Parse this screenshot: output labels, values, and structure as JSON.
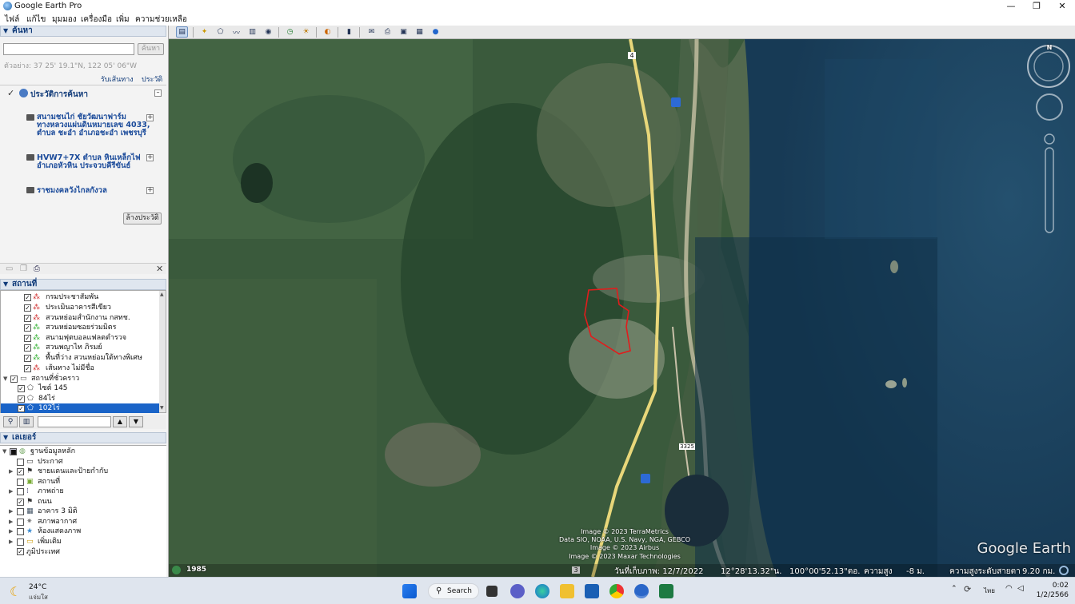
{
  "window": {
    "title": "Google Earth Pro",
    "minimize": "—",
    "maximize": "❐",
    "close": "✕"
  },
  "menu": [
    "ไฟล์",
    "แก้ไข",
    "มุมมอง",
    "เครื่องมือ",
    "เพิ่ม",
    "ความช่วยเหลือ"
  ],
  "search": {
    "header": "ค้นหา",
    "input_value": "",
    "button": "ค้นหา",
    "example": "ตัวอย่าง: 37 25' 19.1\"N, 122 05' 06\"W",
    "link_directions": "รับเส้นทาง",
    "link_history": "ประวัติ",
    "history_title": "ประวัติการค้นหา",
    "history_items": [
      "สนามชนไก่ ชัยวัฒนาฟาร์ม ทางหลวงแผ่นดินหมายเลข 4033, ตำบล ชะอำ อำเภอชะอำ เพชรบุรี",
      "HVW7+7X ตำบล หินเหล็กไฟ อำเภอหัวหิน ประจวบคีรีขันธ์",
      "ราชมงคลวังไกลกังวล"
    ],
    "clear_history": "ล้างประวัติ"
  },
  "places": {
    "header": "สถานที่",
    "items": [
      "กรมประชาสัมพัน",
      "ประเมินอาคารสีเขียว",
      "สวนหย่อมสำนักงาน กสทช.",
      "สวนหย่อมซอยร่วมมิตร",
      "สนามฟุตบอลแฟลตตำรวจ",
      "สวนพญาไท ภิรมย์",
      "พื้นที่ว่าง สวนหย่อมใต้ทางพิเศษ",
      "เส้นทาง ไม่มีชื่อ"
    ],
    "temp_folder": "สถานที่ชั่วคราว",
    "temp_items": [
      "ไซต์ 145",
      "84ไร่",
      "102ไร่"
    ],
    "filter_value": ""
  },
  "layers": {
    "header": "เลเยอร์",
    "root": "ฐานข้อมูลหลัก",
    "items": [
      {
        "label": "ประกาศ",
        "checked": false
      },
      {
        "label": "ชายแดนและป้ายกำกับ",
        "checked": true
      },
      {
        "label": "สถานที่",
        "checked": false
      },
      {
        "label": "ภาพถ่าย",
        "checked": false
      },
      {
        "label": "ถนน",
        "checked": true
      },
      {
        "label": "อาคาร 3 มิติ",
        "checked": false
      },
      {
        "label": "สภาพอากาศ",
        "checked": false
      },
      {
        "label": "ห้องแสดงภาพ",
        "checked": false
      },
      {
        "label": "เพิ่มเติม",
        "checked": false
      }
    ],
    "terrain": "ภูมิประเทศ"
  },
  "map": {
    "road_shields": [
      "4",
      "3325",
      "3"
    ],
    "credits": [
      "Image © 2023 TerraMetrics",
      "Data SIO, NOAA, U.S. Navy, NGA, GEBCO",
      "Image © 2023 Airbus",
      "Image © 2023 Maxar Technologies"
    ],
    "watermark": "Google Earth",
    "year": "1985",
    "compass_n": "N",
    "status": {
      "imagery_date": "วันที่เก็บภาพ: 12/7/2022",
      "coords": "12°28'13.32\"น.   100°00'52.13\"ตอ.",
      "elev_label": "ความสูง",
      "elev": "-8 ม.",
      "eye_label": "ความสูงระดับสายตา",
      "eye": "9.20 กม."
    }
  },
  "taskbar": {
    "weather_temp": "24°C",
    "weather_desc": "แจ่มใส",
    "search": "Search",
    "lang": "ไทย",
    "time": "0:02",
    "date": "1/2/2566"
  }
}
